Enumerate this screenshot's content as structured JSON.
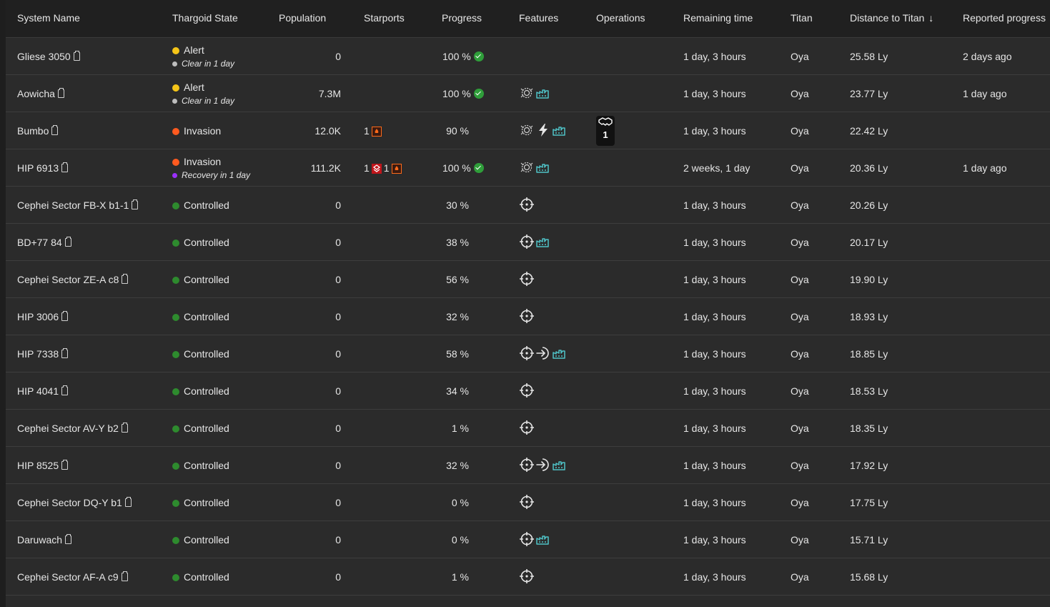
{
  "headers": {
    "system_name": "System Name",
    "thargoid_state": "Thargoid State",
    "population": "Population",
    "starports": "Starports",
    "progress": "Progress",
    "features": "Features",
    "operations": "Operations",
    "remaining_time": "Remaining time",
    "titan": "Titan",
    "distance_to_titan": "Distance to Titan",
    "reported_progress": "Reported progress"
  },
  "colors": {
    "alert": "#f5c518",
    "invasion": "#ff5a1f",
    "controlled": "#2e8b2e",
    "clear": "#bdbdbd",
    "recovery": "#9b30ff",
    "feature_icon": "#4fc3c8",
    "progress_check": "#2f9e3a"
  },
  "rows": [
    {
      "name": "Gliese 3050",
      "state": "Alert",
      "state_color": "alert",
      "sub": "Clear in 1 day",
      "sub_color": "clear",
      "population": "0",
      "starports": [],
      "progress": "100 %",
      "progress_done": true,
      "features": [],
      "ops": "",
      "remaining": "1 day, 3 hours",
      "titan": "Oya",
      "distance": "25.58 Ly",
      "reported": "2 days ago"
    },
    {
      "name": "Aowicha",
      "state": "Alert",
      "state_color": "alert",
      "sub": "Clear in 1 day",
      "sub_color": "clear",
      "population": "7.3M",
      "starports": [],
      "progress": "100 %",
      "progress_done": true,
      "features": [
        "barnacle-icon",
        "factory-icon"
      ],
      "ops": "",
      "remaining": "1 day, 3 hours",
      "titan": "Oya",
      "distance": "23.77 Ly",
      "reported": "1 day ago"
    },
    {
      "name": "Bumbo",
      "state": "Invasion",
      "state_color": "invasion",
      "sub": "",
      "sub_color": "",
      "population": "12.0K",
      "starports": [
        {
          "count": "1",
          "type": "outpost-damaged"
        }
      ],
      "progress": "90 %",
      "progress_done": false,
      "features": [
        "barnacle-icon",
        "lightning-icon",
        "factory-icon"
      ],
      "ops": "1",
      "remaining": "1 day, 3 hours",
      "titan": "Oya",
      "distance": "22.42 Ly",
      "reported": ""
    },
    {
      "name": "HIP 6913",
      "state": "Invasion",
      "state_color": "invasion",
      "sub": "Recovery in 1 day",
      "sub_color": "recovery",
      "population": "111.2K",
      "starports": [
        {
          "count": "1",
          "type": "station-under-attack"
        },
        {
          "count": "1",
          "type": "outpost-damaged"
        }
      ],
      "progress": "100 %",
      "progress_done": true,
      "features": [
        "barnacle-icon",
        "factory-icon"
      ],
      "ops": "",
      "remaining": "2 weeks, 1 day",
      "titan": "Oya",
      "distance": "20.36 Ly",
      "reported": "1 day ago"
    },
    {
      "name": "Cephei Sector FB-X b1-1",
      "state": "Controlled",
      "state_color": "controlled",
      "sub": "",
      "sub_color": "",
      "population": "0",
      "starports": [],
      "progress": "30 %",
      "progress_done": false,
      "features": [
        "target-icon"
      ],
      "ops": "",
      "remaining": "1 day, 3 hours",
      "titan": "Oya",
      "distance": "20.26 Ly",
      "reported": ""
    },
    {
      "name": "BD+77 84",
      "state": "Controlled",
      "state_color": "controlled",
      "sub": "",
      "sub_color": "",
      "population": "0",
      "starports": [],
      "progress": "38 %",
      "progress_done": false,
      "features": [
        "target-icon",
        "factory-icon"
      ],
      "ops": "",
      "remaining": "1 day, 3 hours",
      "titan": "Oya",
      "distance": "20.17 Ly",
      "reported": ""
    },
    {
      "name": "Cephei Sector ZE-A c8",
      "state": "Controlled",
      "state_color": "controlled",
      "sub": "",
      "sub_color": "",
      "population": "0",
      "starports": [],
      "progress": "56 %",
      "progress_done": false,
      "features": [
        "target-icon"
      ],
      "ops": "",
      "remaining": "1 day, 3 hours",
      "titan": "Oya",
      "distance": "19.90 Ly",
      "reported": ""
    },
    {
      "name": "HIP 3006",
      "state": "Controlled",
      "state_color": "controlled",
      "sub": "",
      "sub_color": "",
      "population": "0",
      "starports": [],
      "progress": "32 %",
      "progress_done": false,
      "features": [
        "target-icon"
      ],
      "ops": "",
      "remaining": "1 day, 3 hours",
      "titan": "Oya",
      "distance": "18.93 Ly",
      "reported": ""
    },
    {
      "name": "HIP 7338",
      "state": "Controlled",
      "state_color": "controlled",
      "sub": "",
      "sub_color": "",
      "population": "0",
      "starports": [],
      "progress": "58 %",
      "progress_done": false,
      "features": [
        "target-icon",
        "arrow-in-icon",
        "factory-icon"
      ],
      "ops": "",
      "remaining": "1 day, 3 hours",
      "titan": "Oya",
      "distance": "18.85 Ly",
      "reported": ""
    },
    {
      "name": "HIP 4041",
      "state": "Controlled",
      "state_color": "controlled",
      "sub": "",
      "sub_color": "",
      "population": "0",
      "starports": [],
      "progress": "34 %",
      "progress_done": false,
      "features": [
        "target-icon"
      ],
      "ops": "",
      "remaining": "1 day, 3 hours",
      "titan": "Oya",
      "distance": "18.53 Ly",
      "reported": ""
    },
    {
      "name": "Cephei Sector AV-Y b2",
      "state": "Controlled",
      "state_color": "controlled",
      "sub": "",
      "sub_color": "",
      "population": "0",
      "starports": [],
      "progress": "1 %",
      "progress_done": false,
      "features": [
        "target-icon"
      ],
      "ops": "",
      "remaining": "1 day, 3 hours",
      "titan": "Oya",
      "distance": "18.35 Ly",
      "reported": ""
    },
    {
      "name": "HIP 8525",
      "state": "Controlled",
      "state_color": "controlled",
      "sub": "",
      "sub_color": "",
      "population": "0",
      "starports": [],
      "progress": "32 %",
      "progress_done": false,
      "features": [
        "target-icon",
        "arrow-in-icon",
        "factory-icon"
      ],
      "ops": "",
      "remaining": "1 day, 3 hours",
      "titan": "Oya",
      "distance": "17.92 Ly",
      "reported": ""
    },
    {
      "name": "Cephei Sector DQ-Y b1",
      "state": "Controlled",
      "state_color": "controlled",
      "sub": "",
      "sub_color": "",
      "population": "0",
      "starports": [],
      "progress": "0 %",
      "progress_done": false,
      "features": [
        "target-icon"
      ],
      "ops": "",
      "remaining": "1 day, 3 hours",
      "titan": "Oya",
      "distance": "17.75 Ly",
      "reported": ""
    },
    {
      "name": "Daruwach",
      "state": "Controlled",
      "state_color": "controlled",
      "sub": "",
      "sub_color": "",
      "population": "0",
      "starports": [],
      "progress": "0 %",
      "progress_done": false,
      "features": [
        "target-icon",
        "factory-icon"
      ],
      "ops": "",
      "remaining": "1 day, 3 hours",
      "titan": "Oya",
      "distance": "15.71 Ly",
      "reported": ""
    },
    {
      "name": "Cephei Sector AF-A c9",
      "state": "Controlled",
      "state_color": "controlled",
      "sub": "",
      "sub_color": "",
      "population": "0",
      "starports": [],
      "progress": "1 %",
      "progress_done": false,
      "features": [
        "target-icon"
      ],
      "ops": "",
      "remaining": "1 day, 3 hours",
      "titan": "Oya",
      "distance": "15.68 Ly",
      "reported": ""
    }
  ]
}
